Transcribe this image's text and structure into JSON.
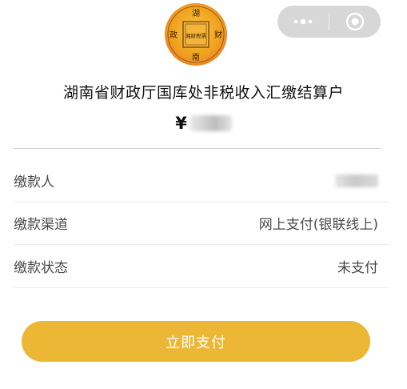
{
  "capsule": {
    "menu_icon": "more-dots-icon",
    "close_icon": "target-circle-icon"
  },
  "logo": {
    "icon": "finance-seal-icon",
    "chars_top": "湖",
    "chars_left": "政",
    "chars_right": "财",
    "chars_bottom": "南",
    "center_text": "湘财税票"
  },
  "header": {
    "title": "湖南省财政厅国库处非税收入汇缴结算户",
    "currency_symbol": "¥"
  },
  "details": {
    "rows": [
      {
        "label": "缴款人",
        "value": ""
      },
      {
        "label": "缴款渠道",
        "value": "网上支付(银联线上)"
      },
      {
        "label": "缴款状态",
        "value": "未支付"
      }
    ]
  },
  "actions": {
    "pay_label": "立即支付"
  },
  "colors": {
    "accent": "#edb736",
    "capsule": "#d7d7d7",
    "logo_gold": "#f0b21e",
    "logo_orange": "#e8892a"
  }
}
